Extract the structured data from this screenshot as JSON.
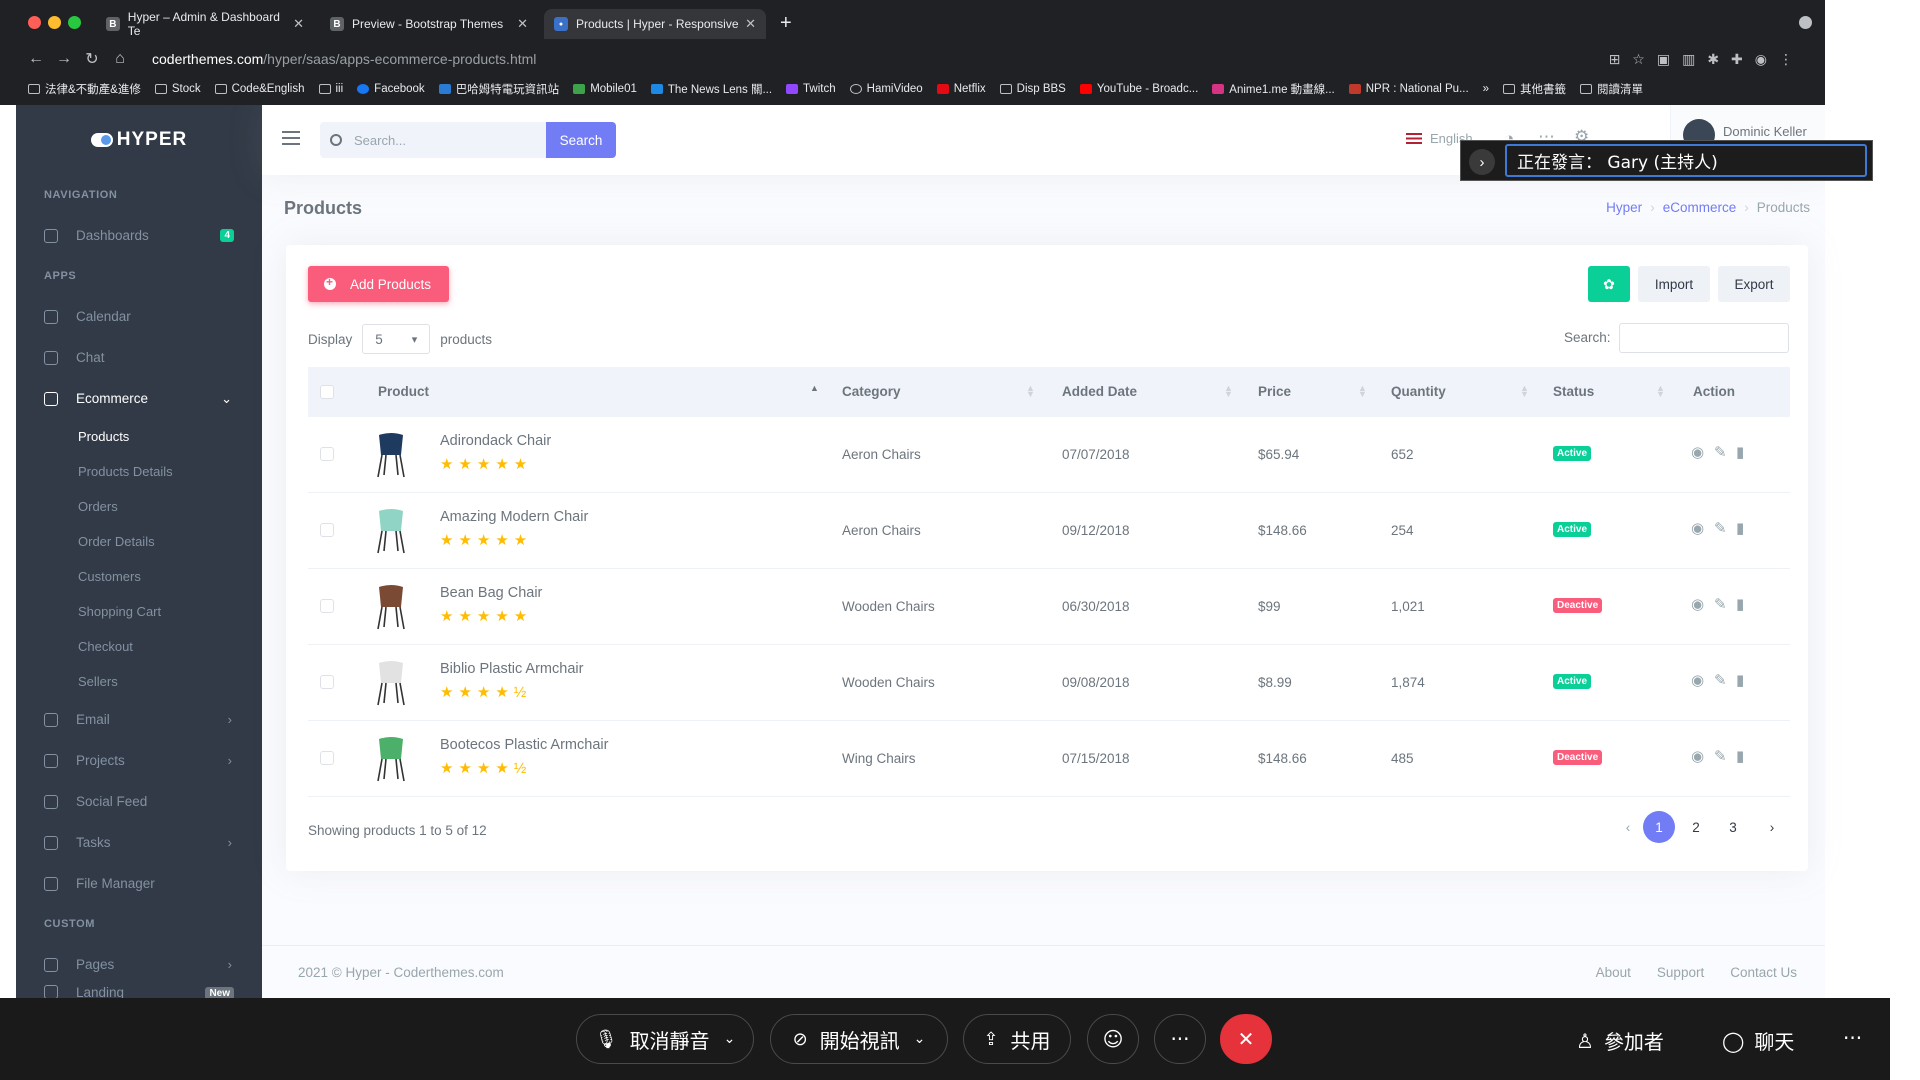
{
  "browser": {
    "tabs": [
      {
        "label": "Hyper – Admin & Dashboard Te",
        "icon": "B"
      },
      {
        "label": "Preview - Bootstrap Themes",
        "icon": "B"
      },
      {
        "label": "Products | Hyper - Responsive",
        "icon": "●"
      }
    ],
    "url_host": "coderthemes.com",
    "url_path": "/hyper/saas/apps-ecommerce-products.html",
    "bookmarks": [
      "法律&不動產&進修",
      "Stock",
      "Code&English",
      "iii",
      "Facebook",
      "巴哈姆特電玩資訊站",
      "Mobile01",
      "The News Lens 關...",
      "Twitch",
      "HamiVideo",
      "Netflix",
      "Disp BBS",
      "YouTube - Broadc...",
      "Anime1.me 動畫線...",
      "NPR : National Pu...",
      "其他書籤",
      "閱讀清單"
    ]
  },
  "sidebar": {
    "logo": "HYPER",
    "sections": {
      "navigation": "NAVIGATION",
      "apps": "APPS",
      "custom": "CUSTOM"
    },
    "dashboards": {
      "label": "Dashboards",
      "badge": "4"
    },
    "items": {
      "calendar": "Calendar",
      "chat": "Chat",
      "ecommerce": "Ecommerce",
      "email": "Email",
      "projects": "Projects",
      "social": "Social Feed",
      "tasks": "Tasks",
      "files": "File Manager",
      "pages": "Pages",
      "landing": "Landing",
      "landing_badge": "New"
    },
    "ecommerce_sub": [
      "Products",
      "Products Details",
      "Orders",
      "Order Details",
      "Customers",
      "Shopping Cart",
      "Checkout",
      "Sellers"
    ]
  },
  "topbar": {
    "search_placeholder": "Search...",
    "search_button": "Search",
    "language": "English",
    "user_name": "Dominic Keller"
  },
  "zoom_caption": {
    "text": "正在發言： Gary (主持人)"
  },
  "page": {
    "title": "Products",
    "breadcrumb": [
      "Hyper",
      "eCommerce",
      "Products"
    ]
  },
  "toolbar": {
    "add": "Add Products",
    "import": "Import",
    "export": "Export",
    "display_label": "Display",
    "display_value": "5",
    "display_suffix": "products",
    "search_label": "Search:"
  },
  "table": {
    "headers": [
      "Product",
      "Category",
      "Added Date",
      "Price",
      "Quantity",
      "Status",
      "Action"
    ],
    "rows": [
      {
        "name": "Adirondack Chair",
        "stars": "★★★★★",
        "category": "Aeron Chairs",
        "date": "07/07/2018",
        "price": "$65.94",
        "qty": "652",
        "status": "Active",
        "color": "#1f3a5f"
      },
      {
        "name": "Amazing Modern Chair",
        "stars": "★★★★★",
        "category": "Aeron Chairs",
        "date": "09/12/2018",
        "price": "$148.66",
        "qty": "254",
        "status": "Active",
        "color": "#8fd4c4"
      },
      {
        "name": "Bean Bag Chair",
        "stars": "★★★★★",
        "category": "Wooden Chairs",
        "date": "06/30/2018",
        "price": "$99",
        "qty": "1,021",
        "status": "Deactive",
        "color": "#7a4a35"
      },
      {
        "name": "Biblio Plastic Armchair",
        "stars": "★★★★½",
        "category": "Wooden Chairs",
        "date": "09/08/2018",
        "price": "$8.99",
        "qty": "1,874",
        "status": "Active",
        "color": "#e2e2e2"
      },
      {
        "name": "Bootecos Plastic Armchair",
        "stars": "★★★★½",
        "category": "Wing Chairs",
        "date": "07/15/2018",
        "price": "$148.66",
        "qty": "485",
        "status": "Deactive",
        "color": "#4caf6a"
      }
    ],
    "status_colors": {
      "Active": "#0acf97",
      "Deactive": "#fa5c7c"
    },
    "showing": "Showing products 1 to 5 of 12",
    "pages": [
      "1",
      "2",
      "3"
    ],
    "prev": "‹",
    "next": "›"
  },
  "footer": {
    "copyright": "2021 © Hyper - Coderthemes.com",
    "links": [
      "About",
      "Support",
      "Contact Us"
    ]
  },
  "zoom": {
    "mute": "取消靜音",
    "video": "開始視訊",
    "share": "共用",
    "participants": "參加者",
    "chat": "聊天",
    "more": "···"
  }
}
